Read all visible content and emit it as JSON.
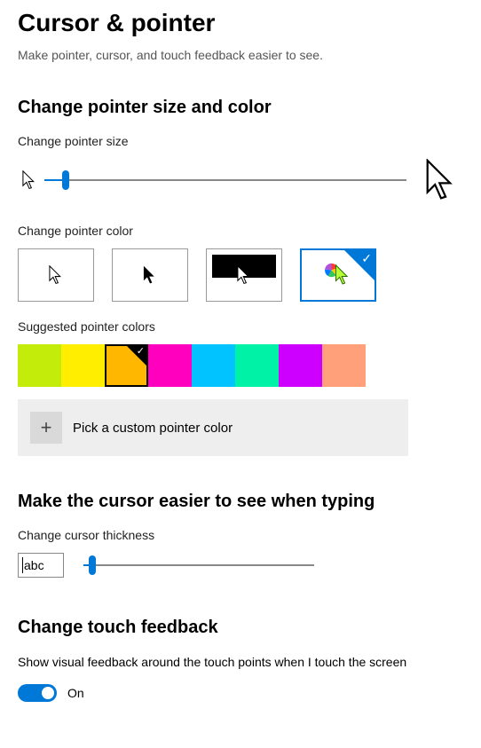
{
  "title": "Cursor & pointer",
  "subtitle": "Make pointer, cursor, and touch feedback easier to see.",
  "sections": {
    "size_color_heading": "Change pointer size and color",
    "size_label": "Change pointer size",
    "pointer_size_slider": {
      "min": 1,
      "max": 15,
      "value": 2,
      "percent": 6
    },
    "color_label": "Change pointer color",
    "color_options": {
      "white": false,
      "black": false,
      "inverted": false,
      "custom": true
    },
    "suggested_label": "Suggested pointer colors",
    "suggested_colors": [
      {
        "hex": "#c4ec0a",
        "selected": false
      },
      {
        "hex": "#ffee00",
        "selected": false
      },
      {
        "hex": "#ffb700",
        "selected": true
      },
      {
        "hex": "#ff00bf",
        "selected": false
      },
      {
        "hex": "#00c3ff",
        "selected": false
      },
      {
        "hex": "#00f2a6",
        "selected": false
      },
      {
        "hex": "#cd00ff",
        "selected": false
      },
      {
        "hex": "#ffa07a",
        "selected": false
      }
    ],
    "custom_color": {
      "label": "Pick a custom pointer color"
    },
    "cursor_heading": "Make the cursor easier to see when typing",
    "thickness_label": "Change cursor thickness",
    "abc_sample": "abc",
    "thickness_slider": {
      "min": 1,
      "max": 20,
      "value": 1,
      "percent": 4
    },
    "touch_heading": "Change touch feedback",
    "touch_text": "Show visual feedback around the touch points when I touch the screen",
    "touch_toggle": {
      "on": true,
      "label": "On"
    }
  }
}
